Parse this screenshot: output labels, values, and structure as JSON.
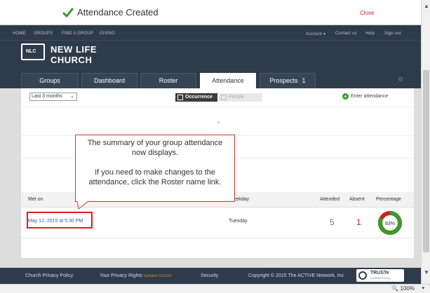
{
  "toast": {
    "title": "Attendance Created",
    "close": "Close"
  },
  "topnav": {
    "home": "HOME",
    "groups": "GROUPS",
    "find_group": "FIND A GROUP",
    "giving": "GIVING",
    "account": "Account ▾",
    "contact": "Contact us",
    "help": "Help",
    "signout": "Sign out"
  },
  "brand": {
    "logo_text": "NLC",
    "line1": "NEW LIFE",
    "line2": "CHURCH"
  },
  "tabs": [
    {
      "label": "Groups"
    },
    {
      "label": "Dashboard"
    },
    {
      "label": "Roster"
    },
    {
      "label": "Attendance"
    },
    {
      "label": "Prospects",
      "badge": "1"
    }
  ],
  "filters": {
    "range": "Last 3 months",
    "occurrence": "Occurrence",
    "people": "People",
    "enter": "Enter attendance"
  },
  "table": {
    "headers": {
      "met_on": "Met on",
      "weekday": "Weekday",
      "attended": "Attended",
      "absent": "Absent",
      "percentage": "Percentage"
    },
    "rows": [
      {
        "date": "May 12, 2015 at 5:30 PM",
        "weekday": "Tuesday",
        "attended": "5",
        "absent": "1",
        "percentage": "83%"
      }
    ]
  },
  "callout": {
    "line1": "The summary of your group attendance",
    "line2": "now displays.",
    "line3": "If you need to make changes to the",
    "line4": "attendance, click the Roster name link."
  },
  "footer": {
    "privacy": "Church Privacy Policy",
    "rights": "Your Privacy Rights",
    "updated": "Updated 12/12/13",
    "security": "Security",
    "copyright": "Copyright © 2015 The ACTIVE Network, Inc",
    "truste": "TRUSTe",
    "truste_sub": "Certified Privacy"
  },
  "status": {
    "zoom": "100%"
  },
  "colors": {
    "accent": "#2e3b4a",
    "green": "#3a9a2a",
    "red": "#e02020"
  }
}
